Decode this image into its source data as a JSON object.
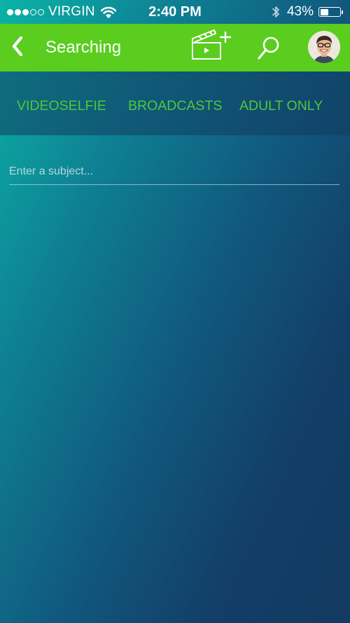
{
  "status_bar": {
    "carrier": "VIRGIN",
    "time": "2:40 PM",
    "battery_percent": "43%",
    "battery_level": 0.43,
    "signal_bars_filled": 3,
    "signal_bars_total": 5
  },
  "nav": {
    "title": "Searching",
    "back_icon": "chevron-left-icon",
    "new_video_icon": "clapperboard-plus-icon",
    "search_icon": "search-icon",
    "avatar_icon": "user-avatar"
  },
  "tabs": [
    {
      "label": "VIDEOSELFIE"
    },
    {
      "label": "BROADCASTS"
    },
    {
      "label": "ADULT ONLY"
    }
  ],
  "subject": {
    "placeholder": "Enter a subject...",
    "value": ""
  },
  "colors": {
    "nav_green": "#5acd1f",
    "tab_text_green": "#4fc83a",
    "background_gradient_start": "#0bb3a6",
    "background_gradient_end": "#133a61"
  }
}
